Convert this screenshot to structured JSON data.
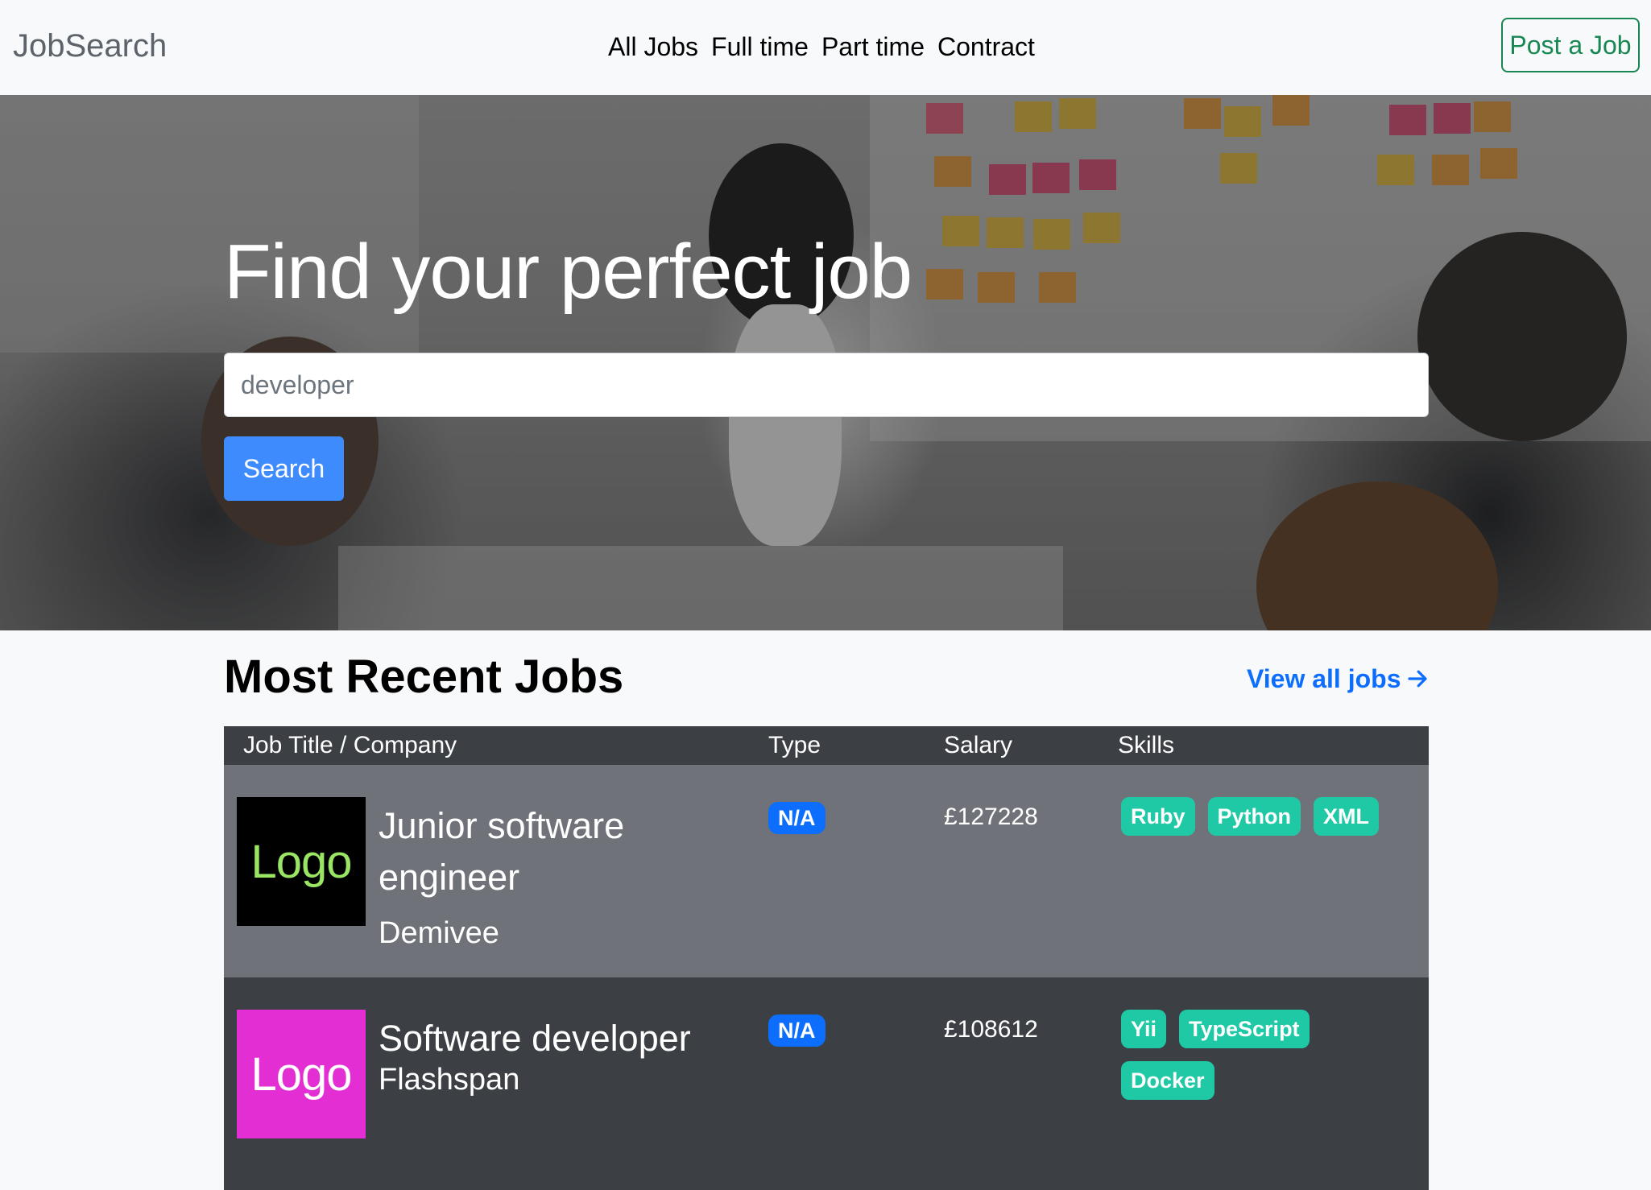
{
  "navbar": {
    "brand": "JobSearch",
    "links": [
      "All Jobs",
      "Full time",
      "Part time",
      "Contract"
    ],
    "post_button": "Post a Job"
  },
  "hero": {
    "title": "Find your perfect job",
    "search_placeholder": "developer",
    "search_button": "Search"
  },
  "recent": {
    "title": "Most Recent Jobs",
    "view_all": "View all jobs",
    "columns": [
      "Job Title / Company",
      "Type",
      "Salary",
      "Skills"
    ],
    "jobs": [
      {
        "title": "Junior software engineer",
        "company": "Demivee",
        "type": "N/A",
        "salary": "£127228",
        "skills": [
          "Ruby",
          "Python",
          "XML"
        ],
        "logo_text": "Logo",
        "logo_bg": "#000000",
        "logo_fg": "#9be564"
      },
      {
        "title": "Software developer",
        "company": "Flashspan",
        "type": "N/A",
        "salary": "£108612",
        "skills": [
          "Yii",
          "TypeScript",
          "Docker"
        ],
        "logo_text": "Logo",
        "logo_bg": "#e22ed2",
        "logo_fg": "#ffffff"
      }
    ]
  },
  "colors": {
    "primary": "#0d6efd",
    "success": "#198754",
    "skill_badge": "#20c9a6",
    "table_dark": "#3c3f44",
    "table_light": "#707279"
  }
}
